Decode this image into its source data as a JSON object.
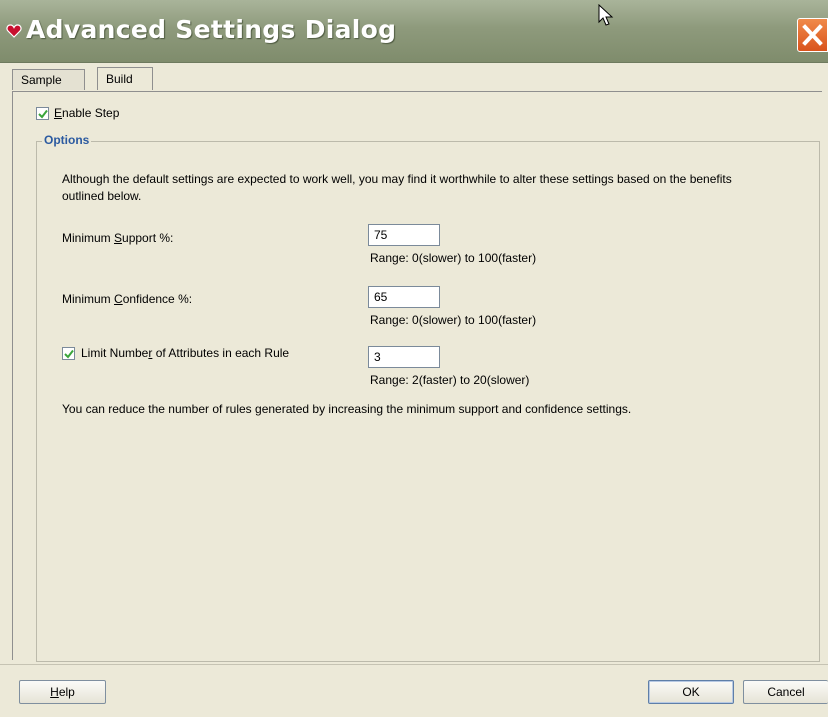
{
  "window": {
    "title": "Advanced Settings Dialog"
  },
  "tabs": [
    {
      "label": "Sample",
      "selected": false
    },
    {
      "label": "Build",
      "selected": true
    }
  ],
  "enable_step": {
    "label_mnemonic": "E",
    "label_rest": "nable Step",
    "checked": true
  },
  "options": {
    "title": "Options",
    "description": "Although the default settings are expected to work well, you may find it worthwhile to alter these settings based on the benefits outlined below.",
    "min_support": {
      "label_pre": "Minimum ",
      "label_mnemonic": "S",
      "label_post": "upport %:",
      "value": "75",
      "range": "Range: 0(slower) to 100(faster)"
    },
    "min_confidence": {
      "label_pre": "Minimum ",
      "label_mnemonic": "C",
      "label_post": "onfidence %:",
      "value": "65",
      "range": "Range: 0(slower) to 100(faster)"
    },
    "limit_attributes": {
      "label_pre": "Limit Numbe",
      "label_mnemonic": "r",
      "label_post": " of Attributes in each Rule",
      "checked": true,
      "value": "3",
      "range": "Range: 2(faster) to 20(slower)"
    },
    "note": "You can reduce the number of rules generated by increasing the minimum support and confidence settings."
  },
  "buttons": {
    "help_mnemonic": "H",
    "help_rest": "elp",
    "ok": "OK",
    "cancel": "Cancel"
  },
  "colors": {
    "titlebar": "#8e9a7c",
    "close": "#e06a2c",
    "group_title": "#2b5aa0",
    "check": "#3aa53a"
  },
  "icons": [
    "app-heart-icon",
    "close-icon",
    "mouse-pointer-icon",
    "checkmark-icon"
  ]
}
